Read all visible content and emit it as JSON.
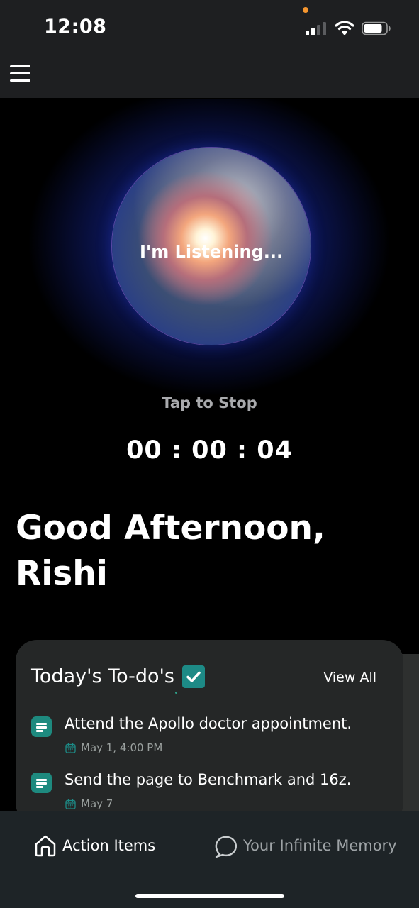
{
  "status_bar": {
    "time": "12:08",
    "icons": [
      "signal-icon",
      "wifi-icon",
      "battery-icon"
    ],
    "recording_indicator_color": "#f5962f"
  },
  "header": {
    "menu_icon": "hamburger-menu-icon"
  },
  "listening": {
    "orb_label": "I'm Listening...",
    "stop_label": "Tap to Stop",
    "timer": "00 : 00 : 04"
  },
  "greeting": {
    "line1": "Good Afternoon,",
    "line2": "Rishi"
  },
  "todos": {
    "title": "Today's To-do's",
    "view_all_label": "View All",
    "accent_color": "#1d8a86",
    "items": [
      {
        "text": "Attend the Apollo doctor appointment.",
        "date": "May 1, 4:00 PM"
      },
      {
        "text": "Send the page to Benchmark and 16z.",
        "date": "May 7"
      }
    ]
  },
  "bottom_nav": {
    "items": [
      {
        "label": "Action Items",
        "icon": "home-icon",
        "active": true
      },
      {
        "label": "Your Infinite Memory",
        "icon": "chat-bubble-icon",
        "active": false
      }
    ],
    "active_color": "#ffffff",
    "inactive_color": "#9ea3a6"
  }
}
